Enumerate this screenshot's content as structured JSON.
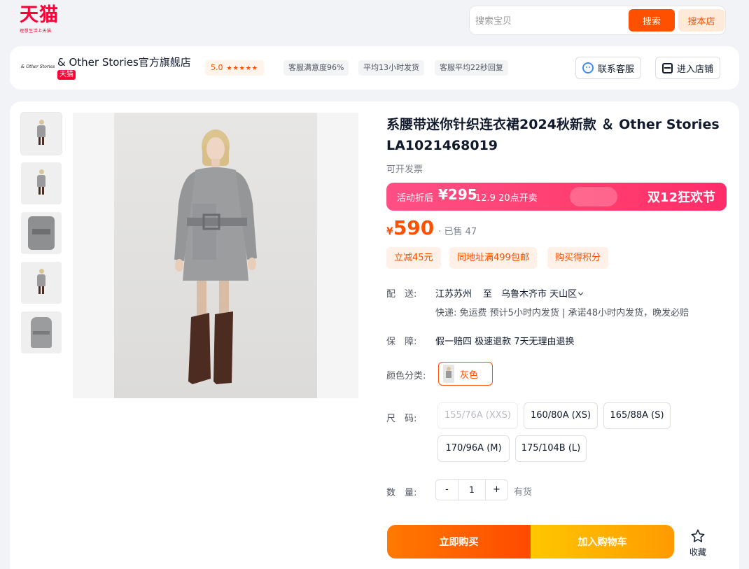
{
  "header": {
    "logo_text": "天猫",
    "logo_sub": "理想生活上天猫",
    "search_placeholder": "搜索宝贝",
    "search_button": "搜索",
    "search_store_button": "搜本店"
  },
  "store": {
    "logo_text": "& Other Stories",
    "name": "& Other Stories官方旗舰店",
    "badge": "天猫",
    "rating": "5.0",
    "stars": "★★★★★",
    "stats": [
      "客服满意度96%",
      "平均13小时发货",
      "客服平均22秒回复"
    ],
    "contact_button": "联系客服",
    "enter_store_button": "进入店铺"
  },
  "product": {
    "title": "系腰带迷你针织连衣裙2024秋新款 ＆ Other Stories LA1021468019",
    "invoice": "可开发票",
    "promo": {
      "label": "活动折后",
      "price": "¥295",
      "time": "12.9 20点开卖",
      "event": "双12狂欢节"
    },
    "price_symbol": "¥",
    "price": "590",
    "sold": "· 已售 47",
    "coupons": [
      "立减45元",
      "同地址满499包邮",
      "购买得积分"
    ],
    "delivery": {
      "label": "配　送:",
      "from": "江苏苏州",
      "to_word": "至",
      "to": "乌鲁木齐市 天山区",
      "detail": "快递: 免运费  预计5小时内发货 | 承诺48小时内发货，晚发必赔"
    },
    "guarantee": {
      "label": "保　障:",
      "text": "假一赔四 极速退款 7天无理由退换"
    },
    "color": {
      "label": "颜色分类:",
      "selected": "灰色"
    },
    "size": {
      "label": "尺　码:",
      "options": [
        {
          "label": "155/76A (XXS)",
          "available": false
        },
        {
          "label": "160/80A (XS)",
          "available": true
        },
        {
          "label": "165/88A (S)",
          "available": true
        },
        {
          "label": "170/96A (M)",
          "available": true
        },
        {
          "label": "175/104B (L)",
          "available": true
        }
      ]
    },
    "quantity": {
      "label": "数　量:",
      "minus": "-",
      "value": "1",
      "plus": "+",
      "stock": "有货"
    },
    "buy_now": "立即购买",
    "add_to_cart": "加入购物车",
    "favorite": "收藏"
  },
  "colors": {
    "tmall_red": "#ff0036",
    "orange": "#ff5000",
    "promo_pink": "#ff3d6e"
  }
}
